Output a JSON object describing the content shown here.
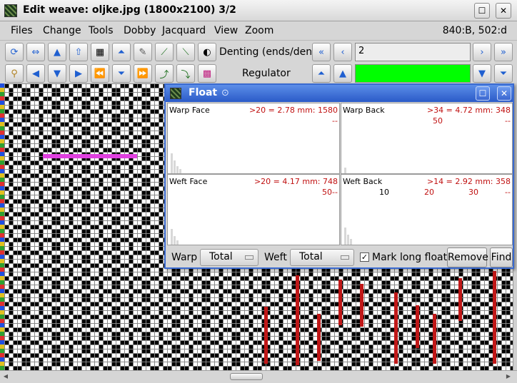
{
  "window": {
    "title": "Edit weave: oljke.jpg (1800x2100) 3/2",
    "maximize_glyph": "☐",
    "close_glyph": "✕"
  },
  "menu": {
    "items": [
      "Files",
      "Change",
      "Tools",
      "Dobby",
      "Jacquard",
      "View",
      "Zoom"
    ],
    "coords": "840:B, 502:d"
  },
  "toolbar": {
    "denting_label": "Denting (ends/dent)",
    "denting_value": "2",
    "regulator_label": "Regulator",
    "regulator_color": "#00ff00"
  },
  "float_dialog": {
    "title": "Float",
    "warp_face": {
      "name": "Warp  Face",
      "stat": ">20 = 2.78 mm: 1580",
      "sub": "--"
    },
    "warp_back": {
      "name": "Warp  Back",
      "stat": ">34 = 4.72 mm: 348",
      "sub1": "50",
      "sub2": "--"
    },
    "weft_face": {
      "name": "Weft  Face",
      "stat": ">20 = 4.17 mm: 748",
      "sub1": "50",
      "sub2": "--"
    },
    "weft_back": {
      "name": "Weft  Back",
      "stat": ">14 = 2.92 mm: 358",
      "ticks": [
        "10",
        "20",
        "30"
      ],
      "sub2": "--"
    },
    "warp_label": "Warp",
    "warp_select": "Total",
    "weft_label": "Weft",
    "weft_select": "Total",
    "mark_long_floats_label": "Mark long floats",
    "mark_long_floats_checked": true,
    "remove_label": "Remove",
    "find_label": "Find"
  },
  "colors": {
    "dialog_title": "#2a5ac8",
    "stat_red": "#c01010",
    "float_magenta": "#e040e0"
  }
}
